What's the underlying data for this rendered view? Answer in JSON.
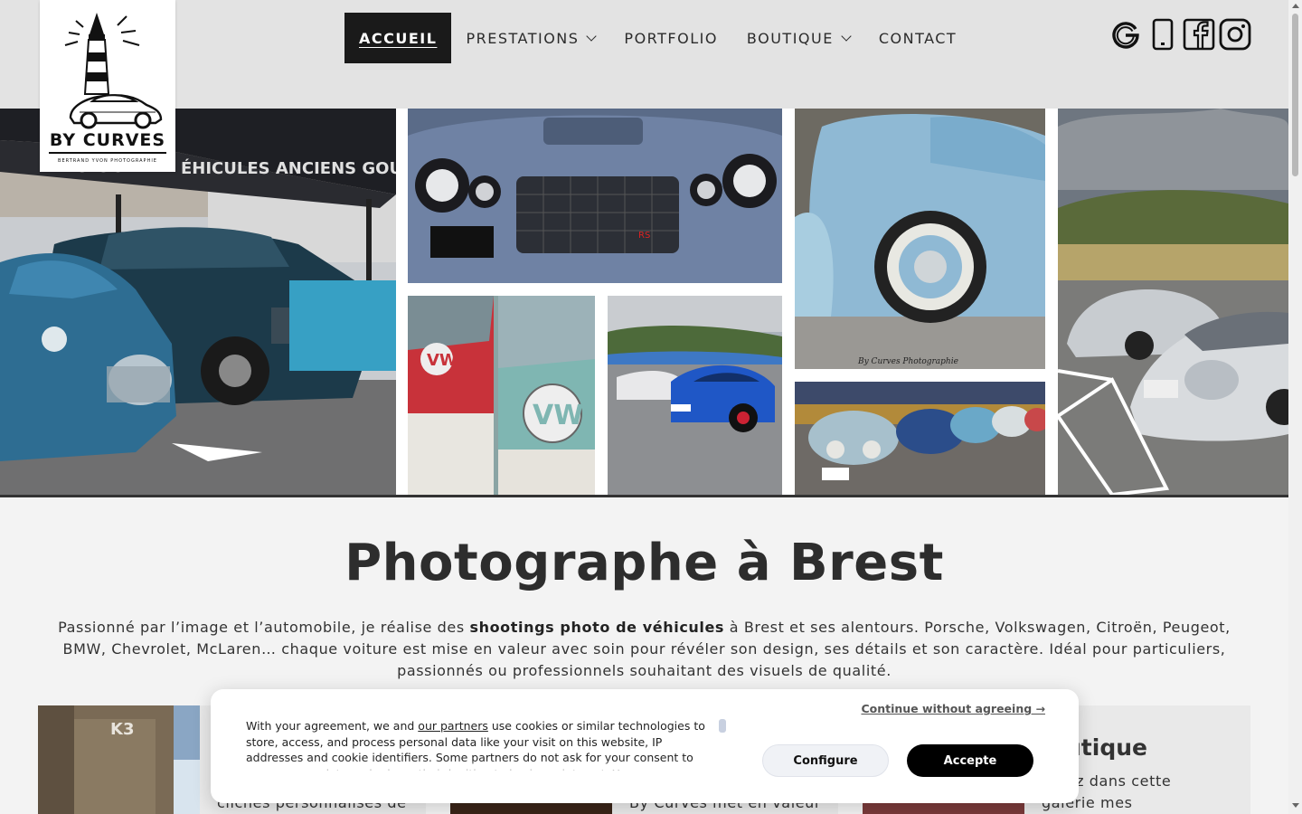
{
  "brand": {
    "name": "BY CURVES",
    "subtitle": "BERTRAND YVON PHOTOGRAPHIE"
  },
  "nav": {
    "items": [
      {
        "label": "ACCUEIL",
        "active": true,
        "dropdown": false
      },
      {
        "label": "PRESTATIONS",
        "active": false,
        "dropdown": true
      },
      {
        "label": "PORTFOLIO",
        "active": false,
        "dropdown": false
      },
      {
        "label": "BOUTIQUE",
        "active": false,
        "dropdown": true
      },
      {
        "label": "CONTACT",
        "active": false,
        "dropdown": false
      }
    ]
  },
  "social": {
    "icons": [
      "google-icon",
      "phone-icon",
      "facebook-icon",
      "instagram-icon"
    ]
  },
  "hero": {
    "photos": [
      "citroen-2cv-and-peugeot-at-show-photo",
      "chevrolet-camaro-front-grille-photo",
      "vw-combi-red-and-green-photo",
      "porsche-911-blue-on-track-photo",
      "vw-beetle-light-blue-photo",
      "vw-beetles-lined-up-photo",
      "porsche-996-silver-photo"
    ]
  },
  "main": {
    "title": "Photographe à Brest",
    "intro_before": "Passionné par l’image et l’automobile, je réalise des ",
    "intro_bold": "shootings photo de véhicules",
    "intro_after": " à Brest et ses alentours. Porsche, Volkswagen, Citroën, Peugeot, BMW, Chevrolet, McLaren… chaque voiture est mise en valeur avec soin pour révéler son design, ses détails et son caractère. Idéal pour particuliers, passionnés ou professionnels souhaitant des visuels de qualité."
  },
  "cards": {
    "card1_text": "clichés personnalisés de",
    "card2_text": "By Curves met en valeur",
    "card3_title": "utique",
    "card3_text_line1": "uvrez dans cette",
    "card3_text_line2": "galerie mes"
  },
  "cookie": {
    "text_before": "With your agreement, we and ",
    "partners_link": "our partners",
    "text_after": " use cookies or similar technologies to store, access, and process personal data like your visit on this website, IP addresses and cookie identifiers. Some partners do not ask for your consent to process your data and rely on their legitimate business interest. You can",
    "continue_label": "Continue without agreeing →",
    "configure_label": "Configure",
    "accept_label": "Accepte"
  },
  "colors": {
    "header_bg": "#e3e3e3",
    "nav_active_bg": "#1a1a1a",
    "page_bg": "#f3f3f3",
    "accept_bg": "#000000"
  }
}
